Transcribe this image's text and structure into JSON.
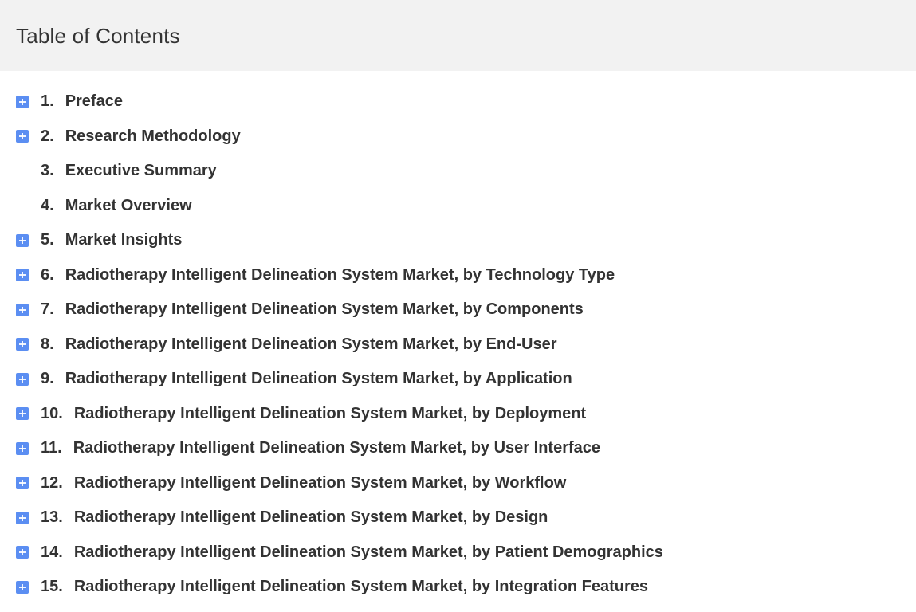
{
  "header": {
    "title": "Table of Contents"
  },
  "toc": {
    "items": [
      {
        "number": "1.",
        "label": "Preface",
        "expandable": true
      },
      {
        "number": "2.",
        "label": "Research Methodology",
        "expandable": true
      },
      {
        "number": "3.",
        "label": "Executive Summary",
        "expandable": false
      },
      {
        "number": "4.",
        "label": "Market Overview",
        "expandable": false
      },
      {
        "number": "5.",
        "label": "Market Insights",
        "expandable": true
      },
      {
        "number": "6.",
        "label": "Radiotherapy Intelligent Delineation System Market, by Technology Type",
        "expandable": true
      },
      {
        "number": "7.",
        "label": "Radiotherapy Intelligent Delineation System Market, by Components",
        "expandable": true
      },
      {
        "number": "8.",
        "label": "Radiotherapy Intelligent Delineation System Market, by End-User",
        "expandable": true
      },
      {
        "number": "9.",
        "label": "Radiotherapy Intelligent Delineation System Market, by Application",
        "expandable": true
      },
      {
        "number": "10.",
        "label": "Radiotherapy Intelligent Delineation System Market, by Deployment",
        "expandable": true
      },
      {
        "number": "11.",
        "label": "Radiotherapy Intelligent Delineation System Market, by User Interface",
        "expandable": true
      },
      {
        "number": "12.",
        "label": "Radiotherapy Intelligent Delineation System Market, by Workflow",
        "expandable": true
      },
      {
        "number": "13.",
        "label": "Radiotherapy Intelligent Delineation System Market, by Design",
        "expandable": true
      },
      {
        "number": "14.",
        "label": "Radiotherapy Intelligent Delineation System Market, by Patient Demographics",
        "expandable": true
      },
      {
        "number": "15.",
        "label": "Radiotherapy Intelligent Delineation System Market, by Integration Features",
        "expandable": true
      }
    ]
  },
  "icons": {
    "expand": "plus-square-icon"
  },
  "colors": {
    "header_bg": "#f2f2f2",
    "icon_bg": "#5b8ef2",
    "text": "#333333"
  }
}
